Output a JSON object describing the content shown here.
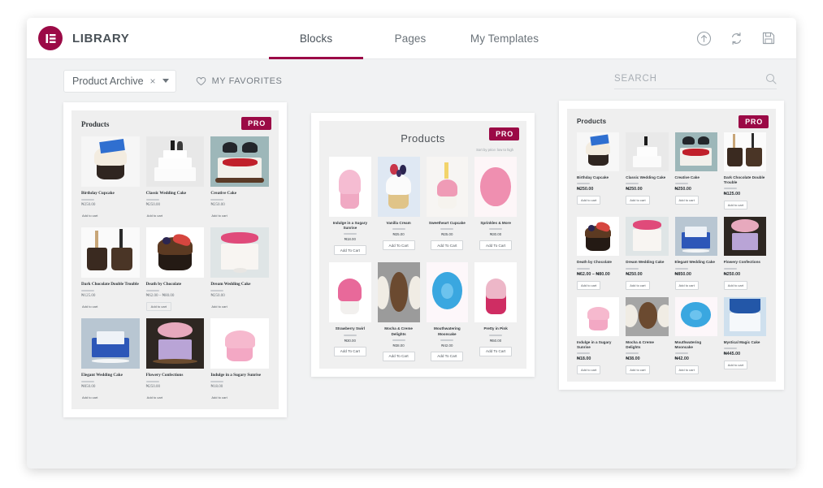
{
  "header": {
    "brand_title": "LIBRARY",
    "logo_icon": "elementor-logo-icon",
    "tabs": [
      {
        "label": "Blocks",
        "active": true
      },
      {
        "label": "Pages",
        "active": false
      },
      {
        "label": "My Templates",
        "active": false
      }
    ],
    "actions": [
      {
        "name": "import-template-icon",
        "label": "Import Template"
      },
      {
        "name": "sync-library-icon",
        "label": "Sync Library"
      },
      {
        "name": "save-template-icon",
        "label": "Save Template"
      }
    ]
  },
  "filter_bar": {
    "category_select": {
      "value": "Product Archive",
      "clear_glyph": "×",
      "caret_icon": "chevron-down-icon"
    },
    "favorites": {
      "label": "MY FAVORITES",
      "icon": "heart-icon"
    },
    "search": {
      "value": "",
      "placeholder": "SEARCH",
      "icon": "search-icon"
    }
  },
  "templates": [
    {
      "id": "products-archive-classic",
      "badge": "PRO",
      "title": "Products",
      "title_style": "serif-left",
      "columns": 3,
      "sort_label": "",
      "cart_label": "Add to cart",
      "products": [
        {
          "name": "Birthday Cupcake",
          "price": "₦250.00"
        },
        {
          "name": "Classic Wedding Cake",
          "price": "₦250.00"
        },
        {
          "name": "Creative Cake",
          "price": "₦250.00"
        },
        {
          "name": "Dark Chocolate Double Trouble",
          "price": "₦125.00"
        },
        {
          "name": "Death by Chocolate",
          "price": "₦62.00 – ₦80.00"
        },
        {
          "name": "Dream Wedding Cake",
          "price": "₦250.00"
        },
        {
          "name": "Elegant Wedding Cake",
          "price": "₦850.00"
        },
        {
          "name": "Flowery Confections",
          "price": "₦250.00"
        },
        {
          "name": "Indulge in a Sugary Sunrise",
          "price": "₦18.00"
        }
      ]
    },
    {
      "id": "products-archive-centered",
      "badge": "PRO",
      "title": "Products",
      "title_style": "sans-center",
      "columns": 4,
      "sort_label": "Sort by price: low to high",
      "cart_label": "Add To Cart",
      "products": [
        {
          "name": "Indulge in a Sugary Sunrise",
          "price": "₦18.00"
        },
        {
          "name": "Vanilla Cream",
          "price": "₦25.00"
        },
        {
          "name": "Sweetheart Cupcake",
          "price": "₦25.00"
        },
        {
          "name": "Sprinkles & More",
          "price": "₦30.00"
        },
        {
          "name": "Strawberry Swirl",
          "price": "₦30.00"
        },
        {
          "name": "Mocha & Creme Delights",
          "price": "₦38.00"
        },
        {
          "name": "Mouthwatering Mooncake",
          "price": "₦42.00"
        },
        {
          "name": "Pretty in Pink",
          "price": "₦50.00"
        }
      ]
    },
    {
      "id": "products-archive-compact",
      "badge": "PRO",
      "title": "Products",
      "title_style": "sans-left",
      "columns": 4,
      "sort_label": "",
      "cart_label": "Add to cart",
      "products": [
        {
          "name": "Birthday Cupcake",
          "price": "₦250.00"
        },
        {
          "name": "Classic Wedding Cake",
          "price": "₦250.00"
        },
        {
          "name": "Creative Cake",
          "price": "₦250.00"
        },
        {
          "name": "Dark Chocolate Double Trouble",
          "price": "₦125.00"
        },
        {
          "name": "Death by Chocolate",
          "price": "₦62.00 – ₦80.00"
        },
        {
          "name": "Dream Wedding Cake",
          "price": "₦250.00"
        },
        {
          "name": "Elegant Wedding Cake",
          "price": "₦850.00"
        },
        {
          "name": "Flowery Confections",
          "price": "₦250.00"
        },
        {
          "name": "Indulge in a Sugary Sunrise",
          "price": "₦18.00"
        },
        {
          "name": "Mocha & Creme Delights",
          "price": "₦38.00"
        },
        {
          "name": "Mouthwatering Mooncake",
          "price": "₦42.00"
        },
        {
          "name": "Mystical Magic Cake",
          "price": "₦445.00"
        }
      ]
    }
  ],
  "colors": {
    "brand": "#9B0A46",
    "header_text": "#495157",
    "modal_bg": "#f1f2f3"
  }
}
